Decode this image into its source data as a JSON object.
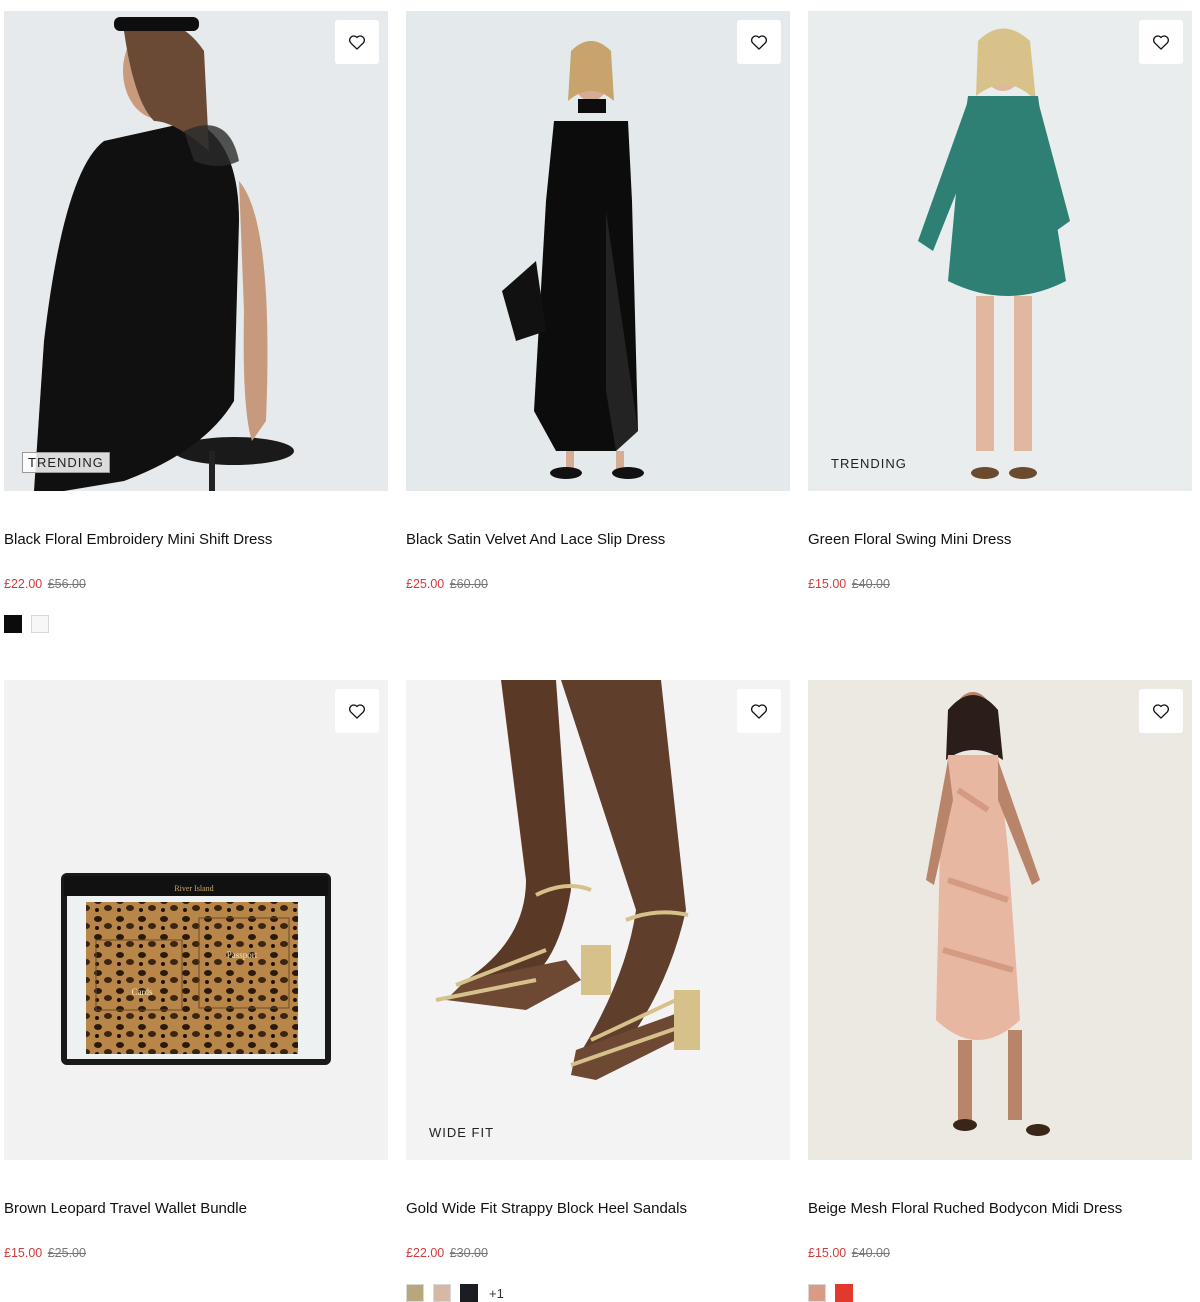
{
  "products": [
    {
      "title": "Black Floral Embroidery Mini Shift Dress",
      "price": "£22.00",
      "was": "£56.00",
      "badge": "TRENDING",
      "swatches": [
        "#0b0b0b",
        "#f7f7f7"
      ],
      "more": ""
    },
    {
      "title": "Black Satin Velvet And Lace Slip Dress",
      "price": "£25.00",
      "was": "£60.00",
      "badge": "",
      "swatches": [],
      "more": ""
    },
    {
      "title": "Green Floral Swing Mini Dress",
      "price": "£15.00",
      "was": "£40.00",
      "badge": "TRENDING",
      "swatches": [],
      "more": ""
    },
    {
      "title": "Brown Leopard Travel Wallet Bundle",
      "price": "£15.00",
      "was": "£25.00",
      "badge": "",
      "swatches": [],
      "more": ""
    },
    {
      "title": "Gold Wide Fit Strappy Block Heel Sandals",
      "price": "£22.00",
      "was": "£30.00",
      "badge": "WIDE FIT",
      "swatches": [
        "#b9a77c",
        "#d6b8a6",
        "#1c1d22"
      ],
      "more": "+1"
    },
    {
      "title": "Beige Mesh Floral Ruched Bodycon Midi Dress",
      "price": "£15.00",
      "was": "£40.00",
      "badge": "",
      "swatches": [
        "#d99a86",
        "#e2382e"
      ],
      "more": ""
    }
  ],
  "wallet_print": {
    "brand": "River Island",
    "passport": "Passport",
    "cards": "Cards"
  },
  "icons": {
    "wishlist": "heart-icon"
  },
  "colors": {
    "sale_price": "#d23b3b",
    "was_price": "#777777"
  }
}
